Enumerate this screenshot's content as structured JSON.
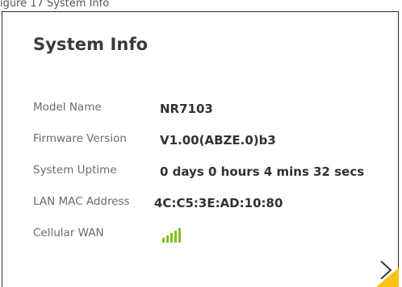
{
  "top_strip": {
    "text": "igure 17   System Info"
  },
  "card": {
    "title": "System Info",
    "rows": [
      {
        "label": "Model Name",
        "value": "NR7103"
      },
      {
        "label": "Firmware Version",
        "value": "V1.00(ABZE.0)b3"
      },
      {
        "label": "System Uptime",
        "value": "0 days 0 hours 4 mins 32 secs"
      },
      {
        "label": "LAN MAC Address",
        "value": "4C:C5:3E:AD:10:80"
      },
      {
        "label": "Cellular WAN",
        "signal_icon": "cellular-signal-icon",
        "signal_bars": 5
      }
    ]
  },
  "next_icon": "chevron-right-icon",
  "colors": {
    "signal": "#7ec31f",
    "chevron_bg": "#f6c316",
    "chevron_line": "#3a3a3a",
    "title": "#3a3a3a",
    "label": "#6b6b6b"
  }
}
